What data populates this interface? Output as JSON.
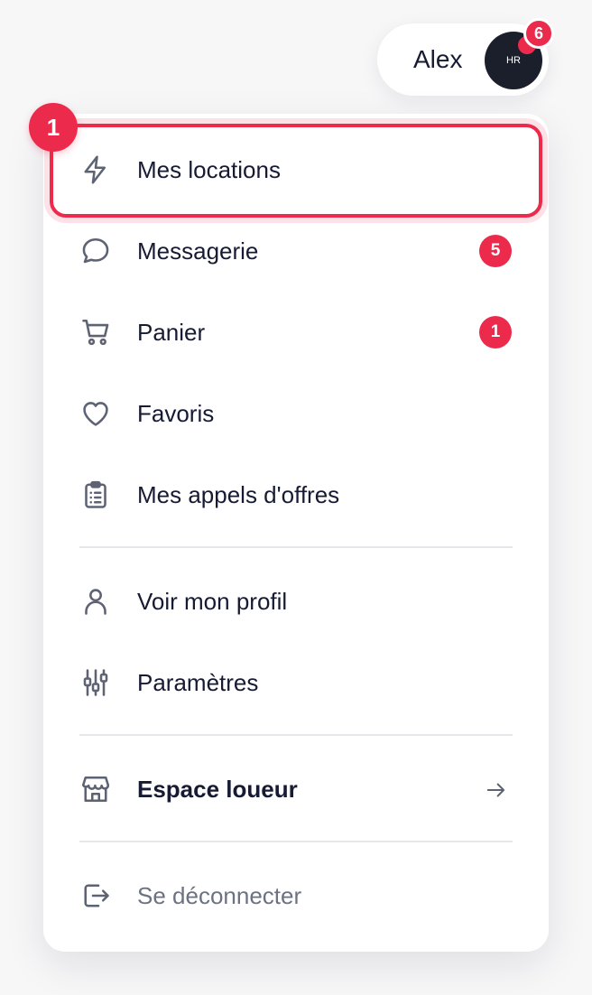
{
  "user": {
    "name": "Alex",
    "avatar_initials": "HR",
    "notification_count": "6"
  },
  "step_marker": "1",
  "menu": {
    "items": [
      {
        "label": "Mes locations",
        "icon": "bolt-icon"
      },
      {
        "label": "Messagerie",
        "icon": "chat-bubble-icon",
        "badge": "5"
      },
      {
        "label": "Panier",
        "icon": "cart-icon",
        "badge": "1"
      },
      {
        "label": "Favoris",
        "icon": "heart-icon"
      },
      {
        "label": "Mes appels d'offres",
        "icon": "clipboard-list-icon"
      }
    ],
    "account_items": [
      {
        "label": "Voir mon profil",
        "icon": "user-icon"
      },
      {
        "label": "Paramètres",
        "icon": "sliders-icon"
      }
    ],
    "owner_space": {
      "label": "Espace loueur",
      "icon": "storefront-icon",
      "action_icon": "arrow-right-icon"
    },
    "logout": {
      "label": "Se déconnecter",
      "icon": "logout-icon"
    }
  },
  "colors": {
    "accent": "#ec2b4c",
    "text": "#161b33",
    "muted_text": "#6b7282",
    "icon": "#5e6374",
    "divider": "#e6e7ea",
    "avatar_bg": "#1b1e2b"
  }
}
